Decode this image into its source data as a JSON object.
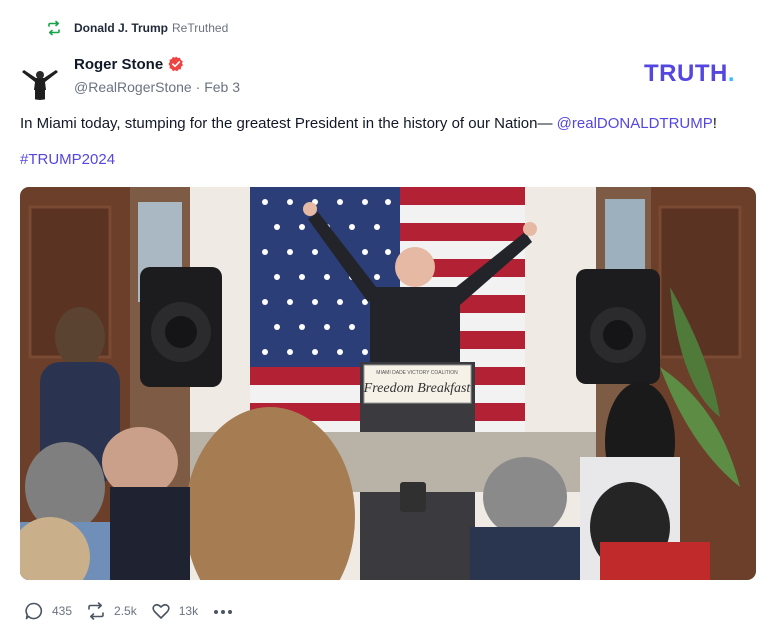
{
  "retruth": {
    "name": "Donald J. Trump",
    "suffix": "ReTruthed"
  },
  "author": {
    "name": "Roger Stone",
    "handle": "@RealRogerStone",
    "date": "Feb 3"
  },
  "brand": {
    "text": "TRUTH",
    "dot": "."
  },
  "post": {
    "text": "In Miami today, stumping for the greatest President in the history of our Nation— ",
    "mention": "@realDONALDTRUMP",
    "after_mention": "!",
    "hashtag": "#TRUMP2024"
  },
  "media": {
    "podium_line1": "Freedom Breakfast",
    "podium_small": "MIAMI DADE VICTORY COALITION"
  },
  "actions": {
    "replies": "435",
    "retruths": "2.5k",
    "likes": "13k"
  },
  "colors": {
    "accent": "#5447e0",
    "brand_dot": "#38bdf8",
    "retruth_green": "#16a34a",
    "verified": "#ef4444",
    "muted": "#6b7280"
  },
  "icons": {
    "retruth": "retruth-icon",
    "verified": "verified-badge-icon",
    "reply": "reply-icon",
    "repost": "retruth-icon",
    "like": "heart-icon",
    "more": "more-icon"
  }
}
